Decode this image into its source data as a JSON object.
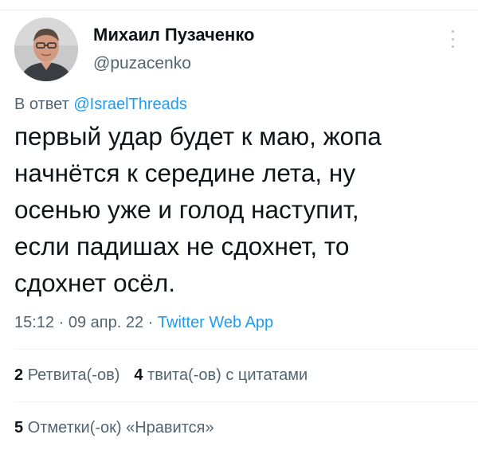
{
  "author": {
    "display_name": "Михаил Пузаченко",
    "handle": "@puzacenko",
    "avatar_icon": "user-avatar-photo"
  },
  "reply_context": {
    "prefix": "В ответ",
    "mention": "@IsraelThreads"
  },
  "tweet": {
    "lines": [
      "первый удар будет к маю, жопа",
      "начнётся к середине лета, ну",
      "осенью уже и голод наступит,",
      "если падишах не сдохнет, то",
      "сдохнет осёл."
    ]
  },
  "meta": {
    "time": "15:12",
    "date": "09 апр. 22",
    "separator": "·",
    "source": "Twitter Web App"
  },
  "stats": {
    "retweets_count": "2",
    "retweets_label": "Ретвита(-ов)",
    "quotes_count": "4",
    "quotes_label": "твита(-ов) с цитатами",
    "likes_count": "5",
    "likes_label": "Отметки(-ок) «Нравится»"
  },
  "icons": {
    "more": "more-vertical-icon"
  },
  "colors": {
    "text": "#0f1419",
    "secondary": "#536471",
    "link": "#1d9bf0",
    "divider": "#eff3f4"
  }
}
